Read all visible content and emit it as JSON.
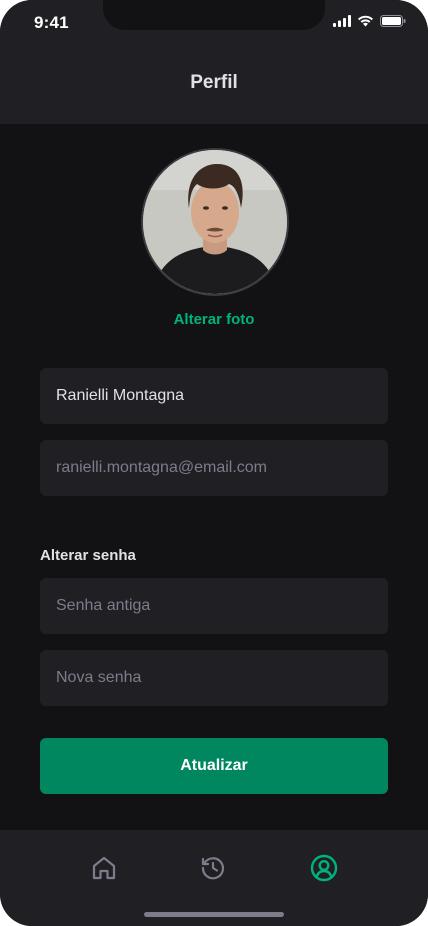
{
  "status_bar": {
    "time": "9:41"
  },
  "header": {
    "title": "Perfil"
  },
  "profile": {
    "change_photo_label": "Alterar foto"
  },
  "form": {
    "name_value": "Ranielli Montagna",
    "email_placeholder": "ranielli.montagna@email.com",
    "password_section_label": "Alterar senha",
    "old_password_placeholder": "Senha antiga",
    "new_password_placeholder": "Nova senha",
    "submit_label": "Atualizar"
  },
  "tab_bar": {
    "items": [
      {
        "icon": "home-icon",
        "active": false
      },
      {
        "icon": "history-icon",
        "active": false
      },
      {
        "icon": "profile-icon",
        "active": true
      }
    ]
  },
  "colors": {
    "background": "#121214",
    "surface": "#202024",
    "accent": "#00b37e",
    "button": "#00875f",
    "text": "#e1e1e6",
    "placeholder": "#7c7c8a"
  }
}
